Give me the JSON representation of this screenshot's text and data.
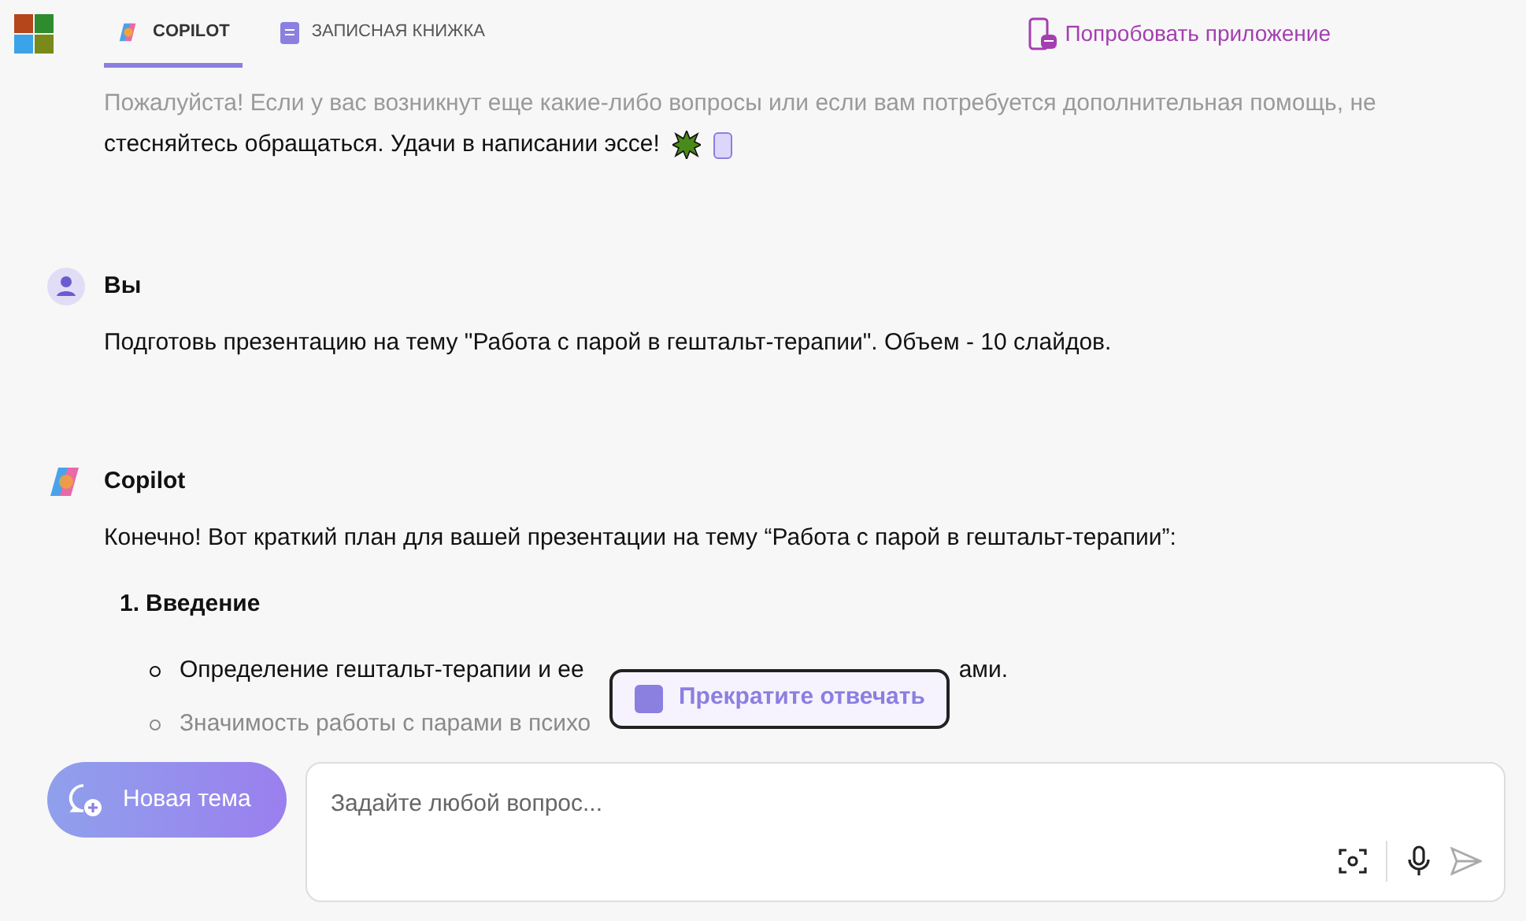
{
  "tabs": [
    {
      "label": "COPILOT",
      "selected": true
    },
    {
      "label": "ЗАПИСНАЯ КНИЖКА",
      "selected": false
    }
  ],
  "try_app_link": "Попробовать приложение",
  "previous_reply": [
    {
      "text": "Пожалуйста! Если у вас возникнут еще какие-либо вопросы или если вам потребуется дополнительная помощь, не",
      "faded": true
    },
    {
      "text": "стесняйтесь обращаться. Удачи в написании эссе!",
      "faded": false
    }
  ],
  "messages": [
    {
      "kind": "user",
      "author": "Вы",
      "text": "Подготовь презентацию на тему \"Работа с парой в гештальт-терапии\". Объем - 10 слайдов."
    },
    {
      "kind": "copilot",
      "author": "Copilot",
      "text": "Конечно! Вот краткий план для вашей презентации на тему “Работа с парой в гештальт-терапии”:",
      "list": [
        {
          "number": "1.",
          "title": "Введение",
          "bullets": [
            {
              "parts": [
                "Определение гештальт-терапии и ее",
                "ами."
              ],
              "faded": false
            },
            {
              "parts": [
                "Значимость работы с парами в психо"
              ],
              "faded": true
            }
          ]
        }
      ]
    }
  ],
  "stop_button": "Прекратите отвечать",
  "new_topic_button": "Новая тема",
  "input": {
    "placeholder": "Задайте любой вопрос..."
  }
}
